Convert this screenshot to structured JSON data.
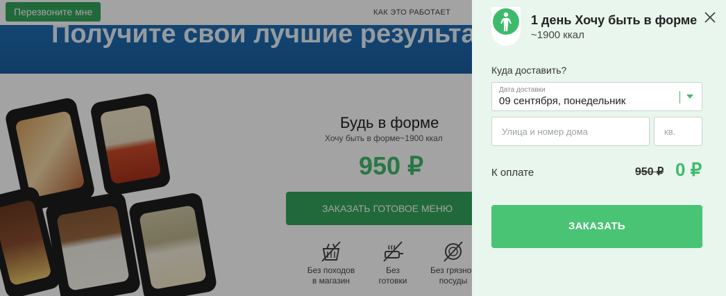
{
  "header": {
    "callback_button": "Перезвоните мне",
    "how_it_works": "КАК ЭТО РАБОТАЕТ"
  },
  "hero": {
    "title": "Получите свои лучшие результаты!"
  },
  "product": {
    "title": "Будь в форме",
    "subtitle": "Хочу быть в форме~1900 ккал",
    "price": "950 ₽",
    "order_button": "ЗАКАЗАТЬ ГОТОВОЕ МЕНЮ"
  },
  "features": [
    {
      "icon": "basket-crossed-icon",
      "label_line1": "Без походов",
      "label_line2": "в магазин"
    },
    {
      "icon": "pan-crossed-icon",
      "label_line1": "Без",
      "label_line2": "готовки"
    },
    {
      "icon": "dishes-crossed-icon",
      "label_line1": "Без грязной",
      "label_line2": "посуды"
    }
  ],
  "panel": {
    "title": "1 день Хочу быть в форме",
    "kcal": "~1900 ккал",
    "where_label": "Куда доставить?",
    "date_caption": "Дата доставки",
    "date_value": "09 сентября, понедельник",
    "street_placeholder": "Улица и номер дома",
    "apt_placeholder": "кв.",
    "pay_label": "К оплате",
    "old_price": "950 ₽",
    "new_price": "0 ₽",
    "order_button": "ЗАКАЗАТЬ"
  },
  "colors": {
    "accent_green": "#3dba6b",
    "button_green": "#48c474",
    "panel_bg": "#e8f6ee",
    "hero_blue": "#1f6db3"
  }
}
